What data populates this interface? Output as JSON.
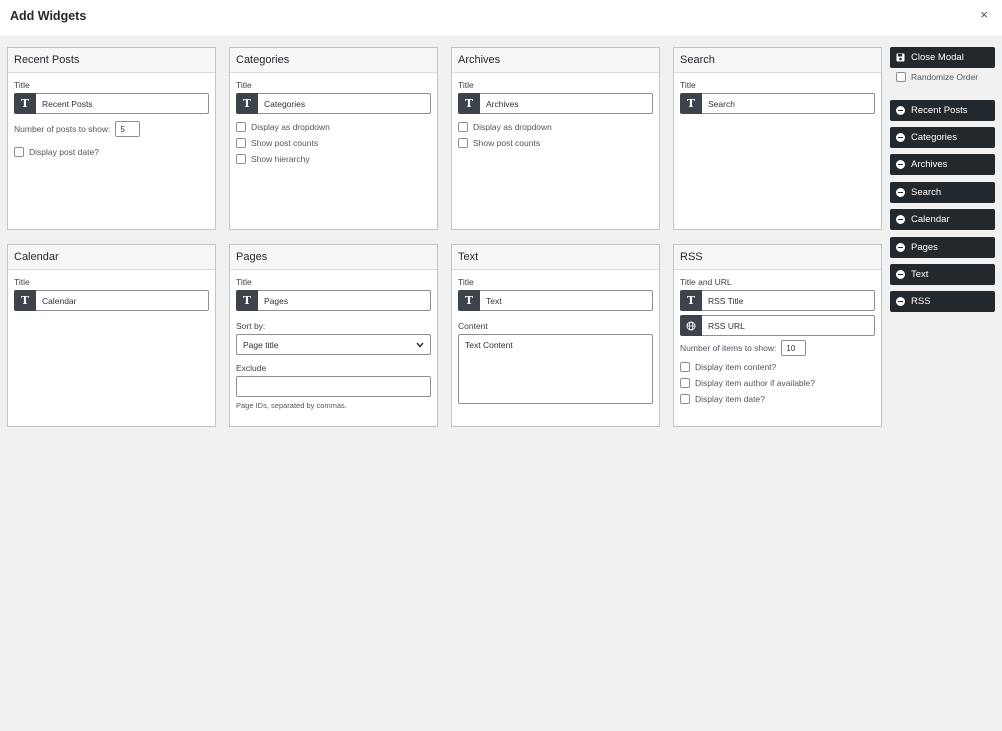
{
  "modal": {
    "title": "Add Widgets",
    "close_glyph": "×"
  },
  "sidebar": {
    "close_label": "Close Modal",
    "randomize_label": "Randomize Order",
    "items": [
      "Recent Posts",
      "Categories",
      "Archives",
      "Search",
      "Calendar",
      "Pages",
      "Text",
      "RSS"
    ]
  },
  "widgets": {
    "recent_posts": {
      "heading": "Recent Posts",
      "title_label": "Title",
      "title_value": "Recent Posts",
      "number_label": "Number of posts to show:",
      "number_value": "5",
      "display_date": "Display post date?",
      "icon": "T"
    },
    "categories": {
      "heading": "Categories",
      "title_label": "Title",
      "title_value": "Categories",
      "opt1": "Display as dropdown",
      "opt2": "Show post counts",
      "opt3": "Show hierarchy",
      "icon": "T"
    },
    "archives": {
      "heading": "Archives",
      "title_label": "Title",
      "title_value": "Archives",
      "opt1": "Display as dropdown",
      "opt2": "Show post counts",
      "icon": "T"
    },
    "search": {
      "heading": "Search",
      "title_label": "Title",
      "title_value": "Search",
      "icon": "T"
    },
    "calendar": {
      "heading": "Calendar",
      "title_label": "Title",
      "title_value": "Calendar",
      "icon": "T"
    },
    "pages": {
      "heading": "Pages",
      "title_label": "Title",
      "title_value": "Pages",
      "sort_label": "Sort by:",
      "sort_value": "Page title",
      "exclude_label": "Exclude",
      "exclude_hint": "Page IDs, separated by commas.",
      "icon": "T"
    },
    "text": {
      "heading": "Text",
      "title_label": "Title",
      "title_value": "Text",
      "content_label": "Content",
      "content_value": "Text Content",
      "icon": "T"
    },
    "rss": {
      "heading": "RSS",
      "title_label": "Title and URL",
      "title_placeholder": "RSS Title",
      "url_placeholder": "RSS URL",
      "number_label": "Number of items to show:",
      "number_value": "10",
      "opt1": "Display item content?",
      "opt2": "Display item author if available?",
      "opt3": "Display item date?",
      "icon": "T"
    }
  }
}
